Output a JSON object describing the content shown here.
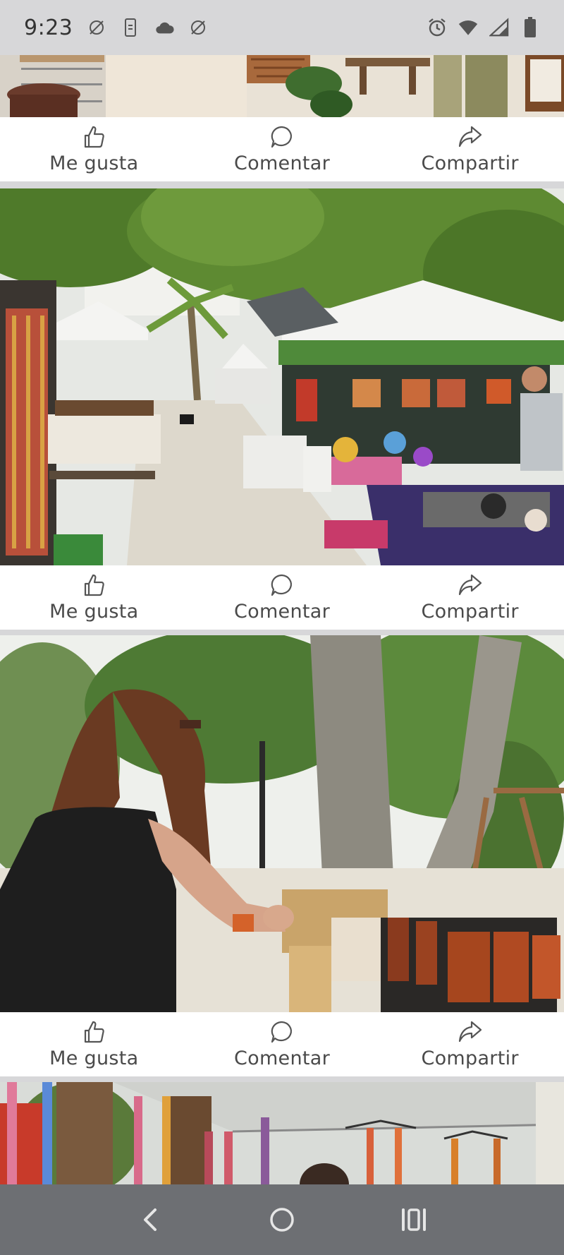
{
  "status_bar": {
    "time": "9:23",
    "left_icons": [
      "no-autorotate-icon",
      "phone-icon",
      "cloud-icon",
      "no-autorotate-icon"
    ],
    "right_icons": [
      "alarm-icon",
      "wifi-icon",
      "signal-icon",
      "battery-icon"
    ]
  },
  "posts": [
    {
      "image": "patio with plants, pottery and wooden bench",
      "actions": {
        "like": "Me gusta",
        "comment": "Comentar",
        "share": "Compartir"
      }
    },
    {
      "image": "outdoor artisan market with tents and tables under trees",
      "actions": {
        "like": "Me gusta",
        "comment": "Comentar",
        "share": "Compartir"
      }
    },
    {
      "image": "woman browsing jars of honey at a market stall",
      "actions": {
        "like": "Me gusta",
        "comment": "Comentar",
        "share": "Compartir"
      }
    },
    {
      "image": "colorful woven straps hanging under a canopy",
      "actions": null
    }
  ],
  "nav_bar": {
    "buttons": [
      "back-icon",
      "home-icon",
      "recents-icon"
    ]
  },
  "colors": {
    "status_bar_bg": "#d7d7d9",
    "nav_bar_bg": "#6d6f73",
    "action_text": "#4a4a4a",
    "divider": "#d7d7d9"
  }
}
